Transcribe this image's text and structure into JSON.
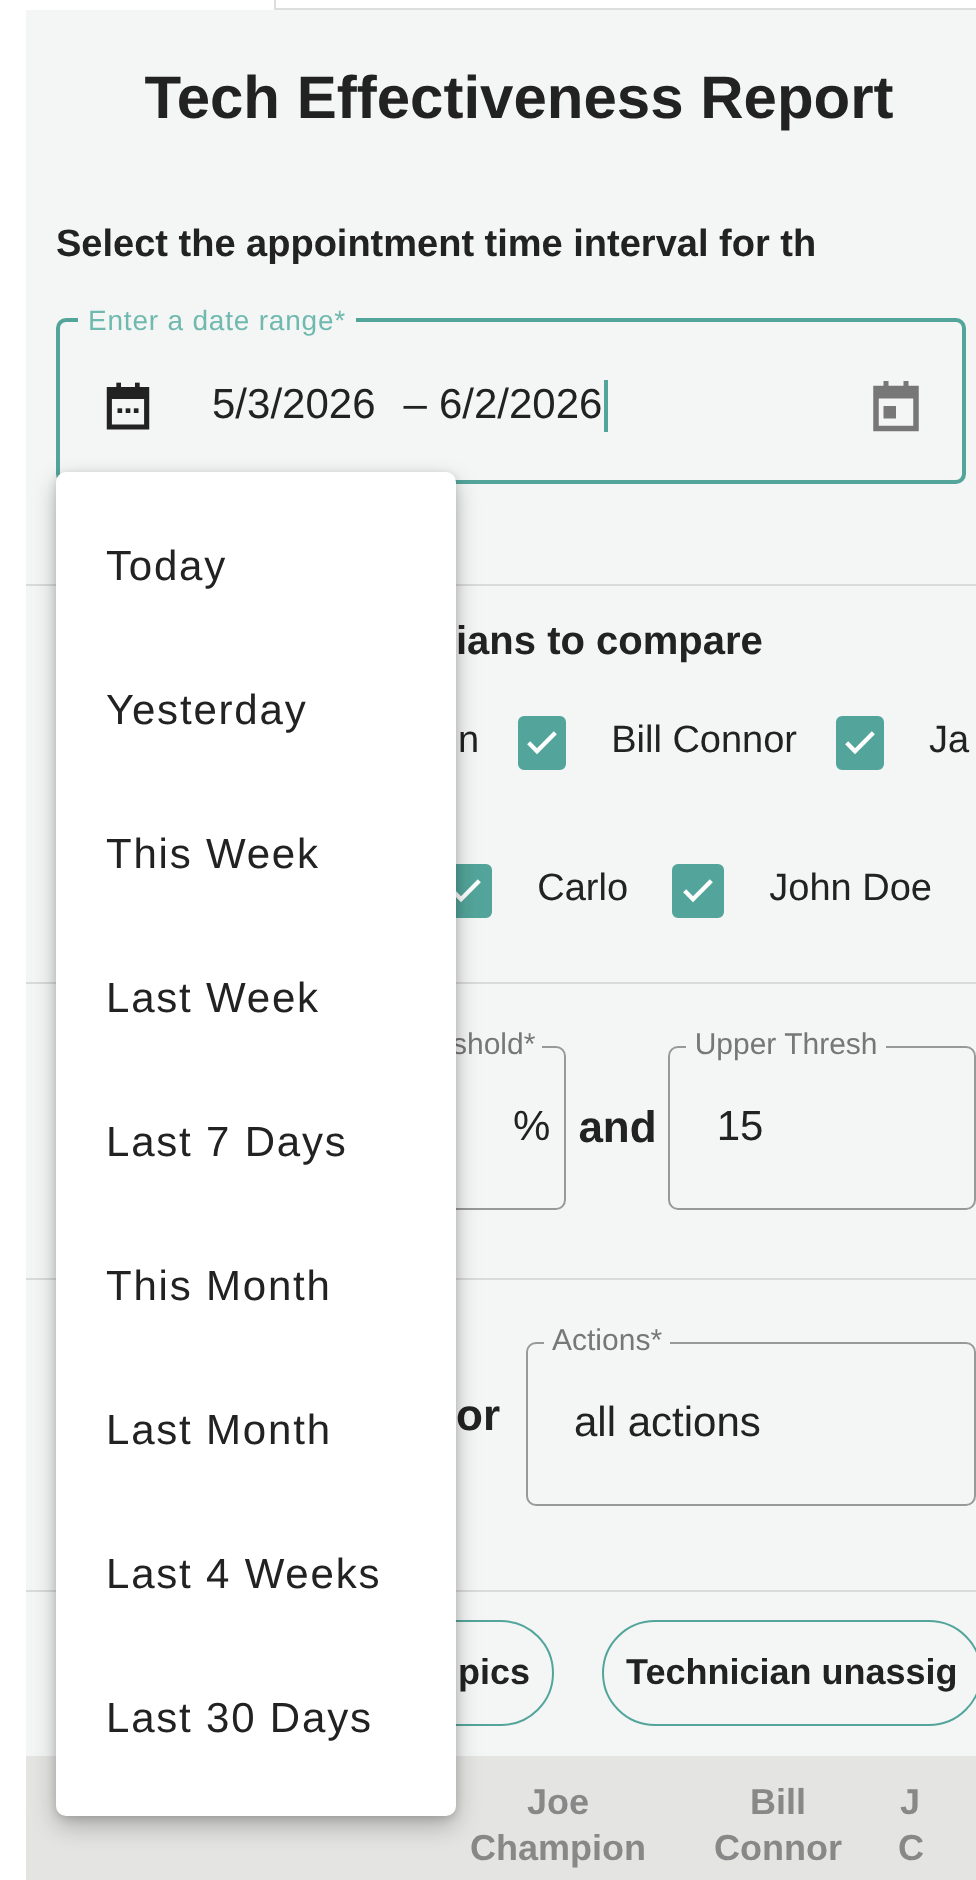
{
  "report": {
    "title": "Tech Effectiveness Report",
    "interval_prompt": "Select the appointment time interval for th"
  },
  "date_range": {
    "label": "Enter a date range*",
    "start": "5/3/2026",
    "separator": "–",
    "end": "6/2/2026",
    "focused": true
  },
  "technicians": {
    "heading": "ians to compare",
    "rows": [
      [
        {
          "label": "n"
        },
        {
          "label": "Bill Connor",
          "checked": true
        },
        {
          "label": "Ja",
          "checked": true
        }
      ],
      [
        {
          "label": "Carlo",
          "checked": true
        },
        {
          "label": "John Doe",
          "checked": true
        }
      ]
    ]
  },
  "threshold": {
    "lower_label": "shold*",
    "lower_unit": "%",
    "joiner": "and",
    "upper_label": "Upper Thresh",
    "upper_value": "15"
  },
  "actions": {
    "lead": "or",
    "label": "Actions*",
    "value": "all actions"
  },
  "chips": [
    {
      "label": "pics"
    },
    {
      "label": "Technician unassig"
    }
  ],
  "table": {
    "columns": [
      "Joe Champion",
      "Bill Connor",
      "J C"
    ]
  },
  "date_presets": [
    {
      "label": "Today"
    },
    {
      "label": "Yesterday"
    },
    {
      "label": "This Week"
    },
    {
      "label": "Last Week"
    },
    {
      "label": "Last 7 Days"
    },
    {
      "label": "This Month"
    },
    {
      "label": "Last Month"
    },
    {
      "label": "Last 4 Weeks"
    },
    {
      "label": "Last 30 Days"
    }
  ]
}
